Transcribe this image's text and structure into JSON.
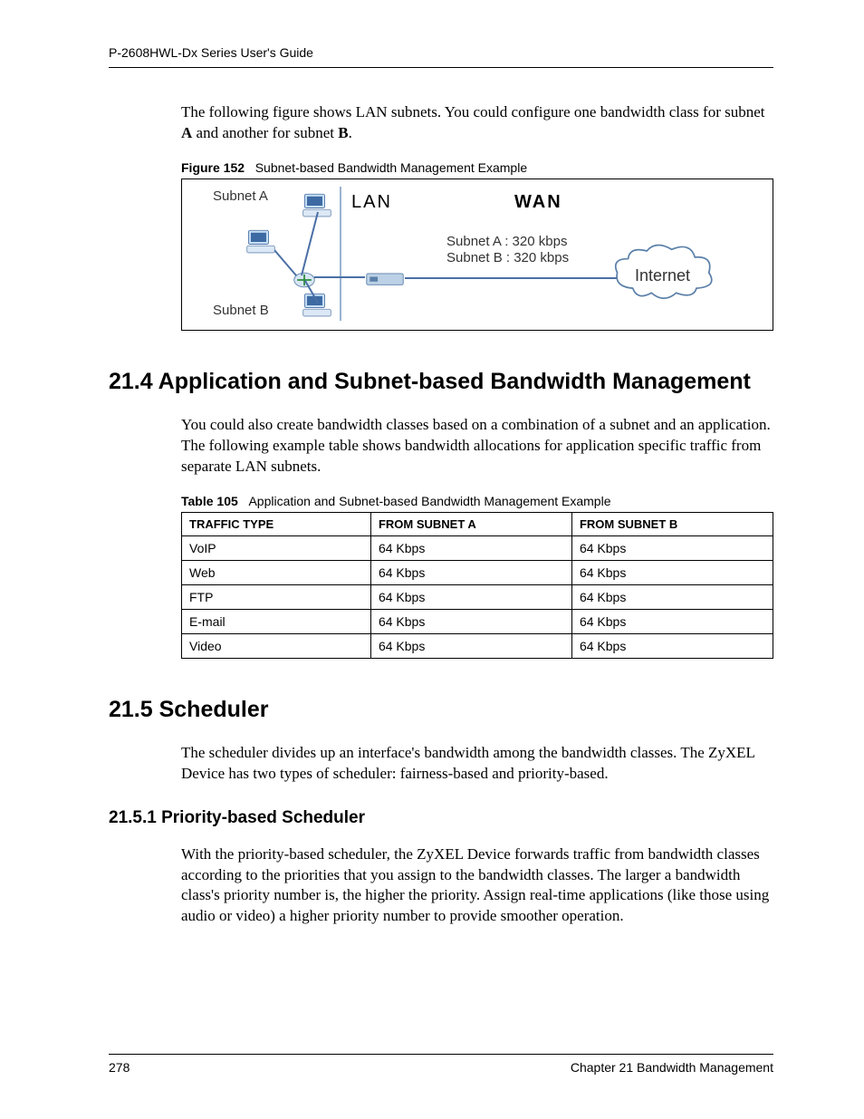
{
  "header": {
    "running_head": "P-2608HWL-Dx Series User's Guide"
  },
  "intro": {
    "p1_a": "The following figure shows LAN subnets. You could configure one bandwidth class for subnet ",
    "p1_bold1": "A",
    "p1_b": " and another for subnet ",
    "p1_bold2": "B",
    "p1_c": "."
  },
  "figure": {
    "label": "Figure 152",
    "title": "Subnet-based Bandwidth Management Example",
    "subnet_a": "Subnet A",
    "subnet_b": "Subnet B",
    "lan": "LAN",
    "wan": "WAN",
    "line1": "Subnet A : 320 kbps",
    "line2": "Subnet B : 320 kbps",
    "internet": "Internet"
  },
  "sec214": {
    "heading": "21.4  Application and Subnet-based Bandwidth Management",
    "p1": "You could also create bandwidth classes based on a combination of a subnet and an application. The following example table shows bandwidth allocations for application specific traffic from separate LAN subnets."
  },
  "table": {
    "label": "Table 105",
    "title": "Application and Subnet-based Bandwidth Management Example",
    "headers": [
      "TRAFFIC TYPE",
      "FROM SUBNET A",
      "FROM SUBNET B"
    ],
    "rows": [
      [
        "VoIP",
        "64 Kbps",
        "64 Kbps"
      ],
      [
        "Web",
        "64 Kbps",
        "64 Kbps"
      ],
      [
        "FTP",
        "64 Kbps",
        "64 Kbps"
      ],
      [
        "E-mail",
        "64 Kbps",
        "64 Kbps"
      ],
      [
        "Video",
        "64 Kbps",
        "64 Kbps"
      ]
    ]
  },
  "sec215": {
    "heading": "21.5  Scheduler",
    "p1": "The scheduler divides up an interface's bandwidth among the bandwidth classes. The ZyXEL Device has two types of scheduler: fairness-based and priority-based."
  },
  "sec2151": {
    "heading": "21.5.1  Priority-based Scheduler",
    "p1": "With the priority-based scheduler, the ZyXEL Device forwards traffic from bandwidth classes according to the priorities that you assign to the bandwidth classes. The larger a bandwidth class's priority number is, the higher the priority. Assign real-time applications (like those using audio or video) a higher priority number to provide smoother operation."
  },
  "footer": {
    "page": "278",
    "chapter": "Chapter 21 Bandwidth Management"
  }
}
